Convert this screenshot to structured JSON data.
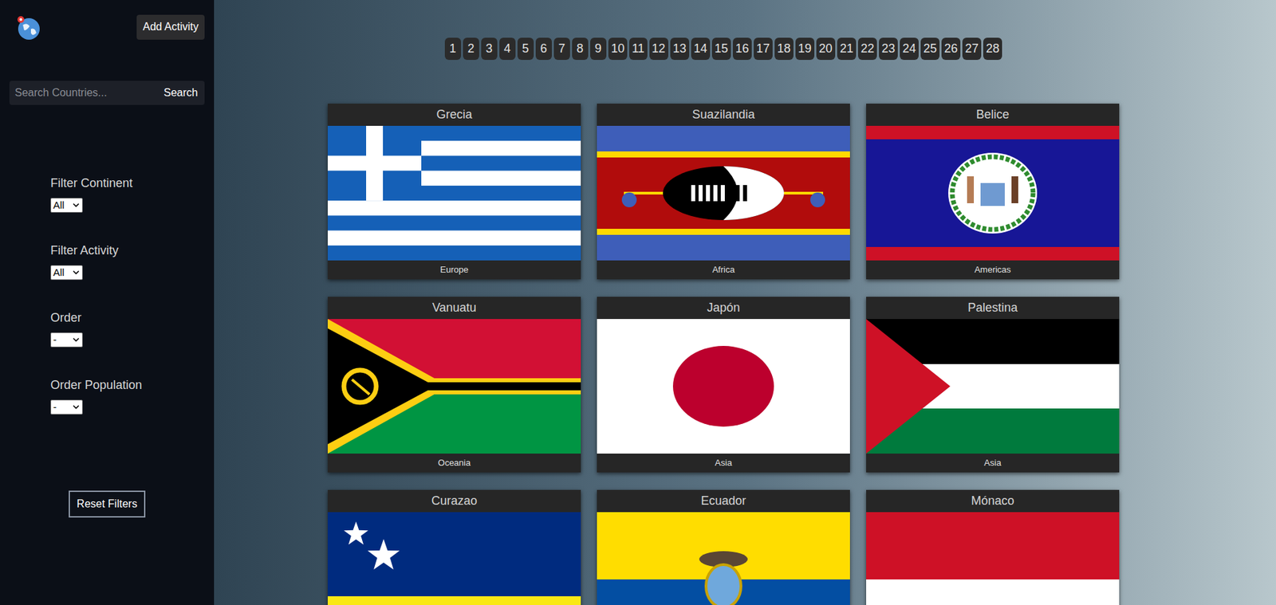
{
  "sidebar": {
    "add_activity": "Add Activity",
    "search": {
      "placeholder": "Search Countries...",
      "button": "Search"
    },
    "filters": [
      {
        "label": "Filter Continent",
        "value": "All"
      },
      {
        "label": "Filter Activity",
        "value": "All"
      },
      {
        "label": "Order",
        "value": "-"
      },
      {
        "label": "Order Population",
        "value": "-"
      }
    ],
    "reset": "Reset Filters"
  },
  "pagination": [
    "1",
    "2",
    "3",
    "4",
    "5",
    "6",
    "7",
    "8",
    "9",
    "10",
    "11",
    "12",
    "13",
    "14",
    "15",
    "16",
    "17",
    "18",
    "19",
    "20",
    "21",
    "22",
    "23",
    "24",
    "25",
    "26",
    "27",
    "28"
  ],
  "cards": [
    {
      "name": "Grecia",
      "continent": "Europe"
    },
    {
      "name": "Suazilandia",
      "continent": "Africa"
    },
    {
      "name": "Belice",
      "continent": "Americas"
    },
    {
      "name": "Vanuatu",
      "continent": "Oceania"
    },
    {
      "name": "Japón",
      "continent": "Asia"
    },
    {
      "name": "Palestina",
      "continent": "Asia"
    },
    {
      "name": "Curazao",
      "continent": ""
    },
    {
      "name": "Ecuador",
      "continent": ""
    },
    {
      "name": "Mónaco",
      "continent": ""
    }
  ]
}
